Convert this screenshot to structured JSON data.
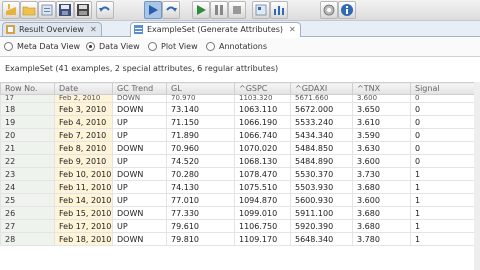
{
  "tabs": [
    {
      "label": "Result Overview",
      "active": false
    },
    {
      "label": "ExampleSet (Generate Attributes)",
      "active": true
    }
  ],
  "views": [
    {
      "label": "Meta Data View",
      "selected": false
    },
    {
      "label": "Data View",
      "selected": true
    },
    {
      "label": "Plot View",
      "selected": false
    },
    {
      "label": "Annotations",
      "selected": false
    }
  ],
  "info": "ExampleSet (41 examples, 2 special attributes, 6 regular attributes)",
  "table": {
    "columns": [
      "Row No.",
      "Date",
      "GC Trend",
      "GL",
      "^GSPC",
      "^GDAXI",
      "^TNX",
      "Signal"
    ],
    "partial_row": [
      "17",
      "Feb 2, 2010",
      "DOWN",
      "70.970",
      "1103.320",
      "5671.660",
      "3.600",
      "0"
    ],
    "rows": [
      [
        "18",
        "Feb 3, 2010",
        "DOWN",
        "73.140",
        "1063.110",
        "5672.000",
        "3.650",
        "0"
      ],
      [
        "19",
        "Feb 4, 2010",
        "UP",
        "71.150",
        "1066.190",
        "5533.240",
        "3.610",
        "0"
      ],
      [
        "20",
        "Feb 7, 2010",
        "UP",
        "71.890",
        "1066.740",
        "5434.340",
        "3.590",
        "0"
      ],
      [
        "21",
        "Feb 8, 2010",
        "DOWN",
        "70.960",
        "1070.020",
        "5484.850",
        "3.630",
        "0"
      ],
      [
        "22",
        "Feb 9, 2010",
        "UP",
        "74.520",
        "1068.130",
        "5484.890",
        "3.600",
        "0"
      ],
      [
        "23",
        "Feb 10, 2010",
        "DOWN",
        "70.280",
        "1078.470",
        "5530.370",
        "3.730",
        "1"
      ],
      [
        "24",
        "Feb 11, 2010",
        "UP",
        "74.130",
        "1075.510",
        "5503.930",
        "3.680",
        "1"
      ],
      [
        "25",
        "Feb 14, 2010",
        "UP",
        "77.010",
        "1094.870",
        "5600.930",
        "3.600",
        "1"
      ],
      [
        "26",
        "Feb 15, 2010",
        "DOWN",
        "77.330",
        "1099.010",
        "5911.100",
        "3.680",
        "1"
      ],
      [
        "27",
        "Feb 17, 2010",
        "UP",
        "79.610",
        "1106.750",
        "5920.390",
        "3.680",
        "1"
      ],
      [
        "28",
        "Feb 18, 2010",
        "DOWN",
        "79.810",
        "1109.170",
        "5648.340",
        "3.780",
        "1"
      ]
    ]
  }
}
